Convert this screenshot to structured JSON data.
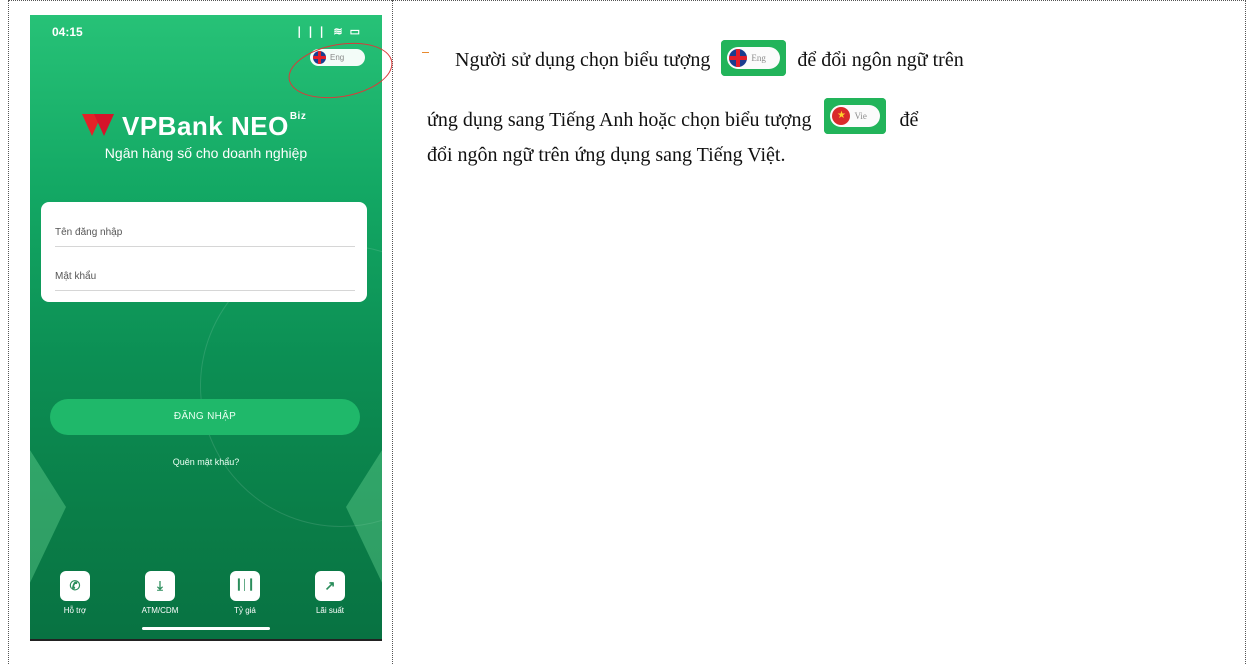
{
  "phone": {
    "status": {
      "time": "04:15",
      "icons": "❘❘❘ ≋ ▭"
    },
    "language_button": {
      "label": "Eng"
    },
    "logo": {
      "brand": "VPBank NEO",
      "sup": "Biz"
    },
    "tagline": "Ngân hàng số cho doanh nghiệp",
    "login_form": {
      "username_placeholder": "Tên đăng nhập",
      "password_placeholder": "Mật khẩu"
    },
    "login_button": "ĐĂNG NHẬP",
    "forgot_password": "Quên mật khẩu?",
    "bottom_nav": [
      {
        "label": "Hỗ trợ",
        "icon": "phone-icon",
        "glyph": "✆"
      },
      {
        "label": "ATM/CDM",
        "icon": "download-icon",
        "glyph": "⤓"
      },
      {
        "label": "Tỷ giá",
        "icon": "bar-chart-icon",
        "glyph": "┃│┃"
      },
      {
        "label": "Lãi suất",
        "icon": "line-chart-icon",
        "glyph": "↗"
      }
    ]
  },
  "description": {
    "bullet": "-",
    "line1_before": "Người sử dụng chọn biểu tượng",
    "chip_eng_label": "Eng",
    "line1_after": "để đổi ngôn ngữ trên",
    "line2_before": "ứng dụng sang Tiếng Anh hoặc chọn biểu tượng",
    "chip_vie_label": "Vie",
    "line2_after": "để",
    "line3": "đổi ngôn ngữ trên ứng dụng sang Tiếng Việt."
  },
  "colors": {
    "accent_green": "#1fb86a",
    "highlight_red": "#d93a3a"
  }
}
